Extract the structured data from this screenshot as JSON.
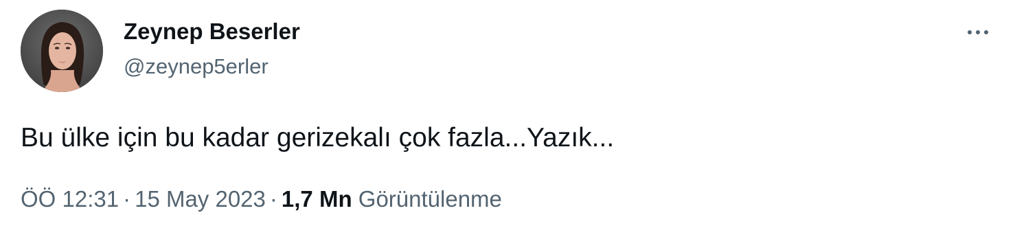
{
  "tweet": {
    "author": {
      "display_name": "Zeynep Beserler",
      "handle": "@zeynep5erler",
      "avatar_icon": "profile-photo"
    },
    "more_icon": "more-horizontal-icon",
    "text": "Bu ülke için bu kadar gerizekalı çok fazla...Yazık...",
    "time": "ÖÖ 12:31",
    "date": "15 May 2023",
    "separator": "·",
    "views_count": "1,7 Mn",
    "views_label": "Görüntülenme"
  },
  "colors": {
    "text_primary": "#0f1419",
    "text_secondary": "#536471",
    "background": "#ffffff"
  }
}
